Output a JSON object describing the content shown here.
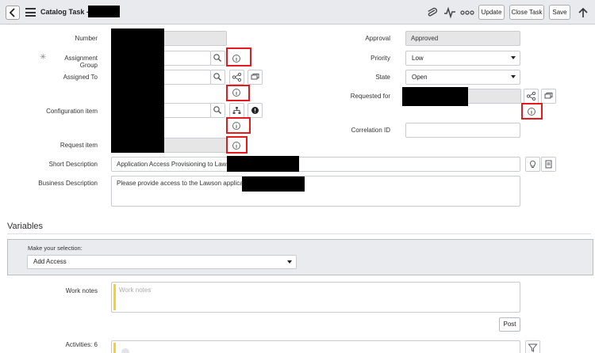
{
  "header": {
    "title": "Catalog Task -",
    "buttons": {
      "update": "Update",
      "close_task": "Close Task",
      "save": "Save"
    },
    "icons": [
      "back-icon",
      "menu-icon",
      "attachment-icon",
      "activity-icon",
      "more-icon",
      "scroll-up-icon"
    ]
  },
  "form": {
    "number": {
      "label": "Number"
    },
    "assignment_group": {
      "label": "Assignment Group",
      "mandatory_mark": "✳"
    },
    "assigned_to": {
      "label": "Assigned To"
    },
    "configuration_item": {
      "label": "Configuration item"
    },
    "request_item": {
      "label": "Request item"
    },
    "approval": {
      "label": "Approval",
      "value": "Approved"
    },
    "priority": {
      "label": "Priority",
      "value": "Low"
    },
    "state": {
      "label": "State",
      "value": "Open"
    },
    "requested_for": {
      "label": "Requested for"
    },
    "correlation_id": {
      "label": "Correlation ID",
      "value": ""
    },
    "short_description": {
      "label": "Short Description",
      "value": "Application Access Provisioning to Lawson"
    },
    "business_description": {
      "label": "Business Description",
      "value": "Please provide access to the Lawson application"
    }
  },
  "variables": {
    "title": "Variables",
    "selection_label": "Make your selection:",
    "selection_value": "Add Access"
  },
  "work_notes": {
    "label": "Work notes",
    "placeholder": "Work notes",
    "post": "Post"
  },
  "activities": {
    "label": "Activities: 6"
  },
  "colors": {
    "highlight": "#e8191c",
    "work_notes_bar": "#f7d320",
    "header_bg": "#e8eaee"
  }
}
